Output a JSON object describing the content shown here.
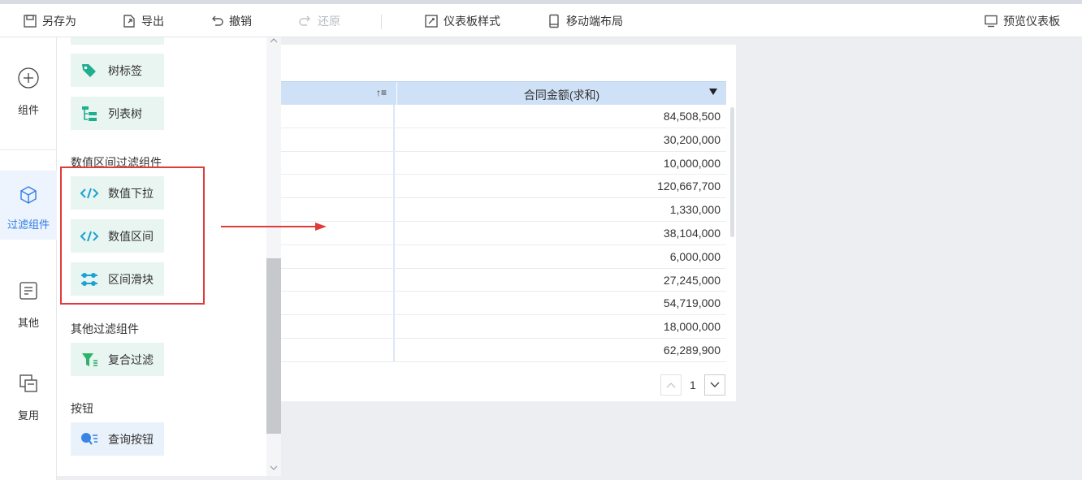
{
  "toolbar": {
    "save_as": "另存为",
    "export": "导出",
    "undo": "撤销",
    "redo": "还原",
    "dashboard_style": "仪表板样式",
    "mobile_layout": "移动端布局",
    "preview": "预览仪表板"
  },
  "nav": {
    "components": "组件",
    "filters": "过滤组件",
    "others": "其他",
    "reuse": "复用"
  },
  "panel": {
    "tree_label": "树标签",
    "list_tree": "列表树",
    "numeric_section": "数值区间过滤组件",
    "numeric_dropdown": "数值下拉",
    "numeric_range": "数值区间",
    "range_slider": "区间滑块",
    "other_section": "其他过滤组件",
    "composite_filter": "复合过滤",
    "button_section": "按钮",
    "query_button": "查询按钮"
  },
  "table": {
    "sort_icon": "↑≡",
    "column_header": "合同金额(求和)",
    "rows": [
      "84,508,500",
      "30,200,000",
      "10,000,000",
      "120,667,700",
      "1,330,000",
      "38,104,000",
      "6,000,000",
      "27,245,000",
      "54,719,000",
      "18,000,000",
      "62,289,900"
    ]
  },
  "pager": {
    "page": "1"
  },
  "colors": {
    "accent": "#2e7ce8",
    "highlight": "#e03b3b",
    "component_bg": "#e9f5f1",
    "header_bg": "#cfe1f7"
  }
}
